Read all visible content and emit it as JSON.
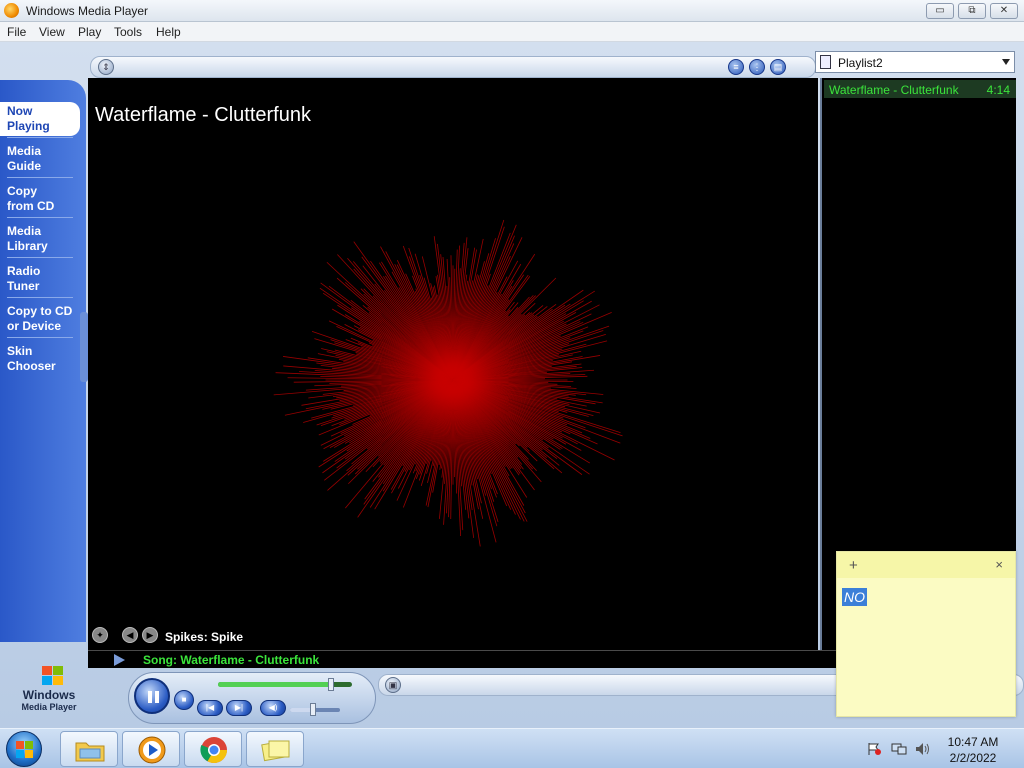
{
  "window": {
    "title": "Windows Media Player",
    "buttons": {
      "minimize": "▭",
      "maximize": "⧉",
      "close": "✕"
    }
  },
  "menu": [
    "File",
    "View",
    "Play",
    "Tools",
    "Help"
  ],
  "nav": {
    "items": [
      {
        "line1": "Now",
        "line2": "Playing",
        "active": true
      },
      {
        "line1": "Media",
        "line2": "Guide"
      },
      {
        "line1": "Copy",
        "line2": "from CD"
      },
      {
        "line1": "Media",
        "line2": "Library"
      },
      {
        "line1": "Radio",
        "line2": "Tuner"
      },
      {
        "line1": "Copy to CD",
        "line2": "or Device"
      },
      {
        "line1": "Skin",
        "line2": "Chooser"
      }
    ]
  },
  "now_playing": {
    "title": "Waterflame - Clutterfunk",
    "visualization": "Spikes: Spike",
    "status_song": "Song: Waterflame - Clutterfunk",
    "seek_fraction": 0.84,
    "volume_fraction": 0.45
  },
  "playlist": {
    "name": "Playlist2",
    "items": [
      {
        "title": "Waterflame - Clutterfunk",
        "duration": "4:14"
      }
    ]
  },
  "logo": {
    "line1": "Windows",
    "line2": "Media Player"
  },
  "sticky_note": {
    "text": "NO",
    "add": "+",
    "close": "×"
  },
  "taskbar": {
    "time": "10:47 AM",
    "date": "2/2/2022"
  },
  "colors": {
    "accent_green": "#3be43b",
    "nav_blue": "#2a58c8",
    "viz_red": "#c80000"
  }
}
